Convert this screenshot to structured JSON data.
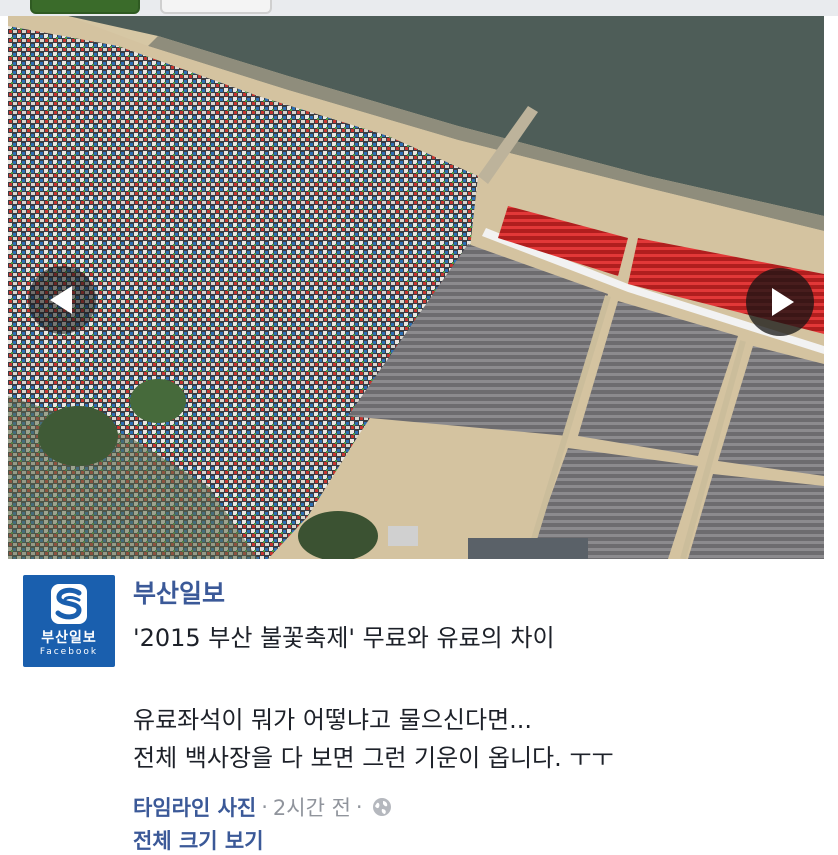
{
  "post": {
    "page_name": "부산일보",
    "title": "'2015 부산 불꽃축제' 무료와 유료의 차이",
    "body_lines": [
      "유료좌석이 뭐가 어떻냐고 물으신다면...",
      "전체 백사장을 다 보면 그런 기운이 옵니다. ㅜㅜ"
    ],
    "meta": {
      "album_link": "타임라인 사진",
      "time": "2시간 전",
      "separator": "·",
      "privacy_icon": "globe-icon"
    },
    "view_full_size": "전체 크기 보기"
  },
  "logo": {
    "name_ko": "부산일보",
    "sub": "Facebook",
    "background": "#1a5fae"
  },
  "photo": {
    "prev_icon": "chevron-left-icon",
    "next_icon": "chevron-right-icon"
  },
  "colors": {
    "link": "#3b5998",
    "text": "#1d2129",
    "meta": "#90949c"
  }
}
